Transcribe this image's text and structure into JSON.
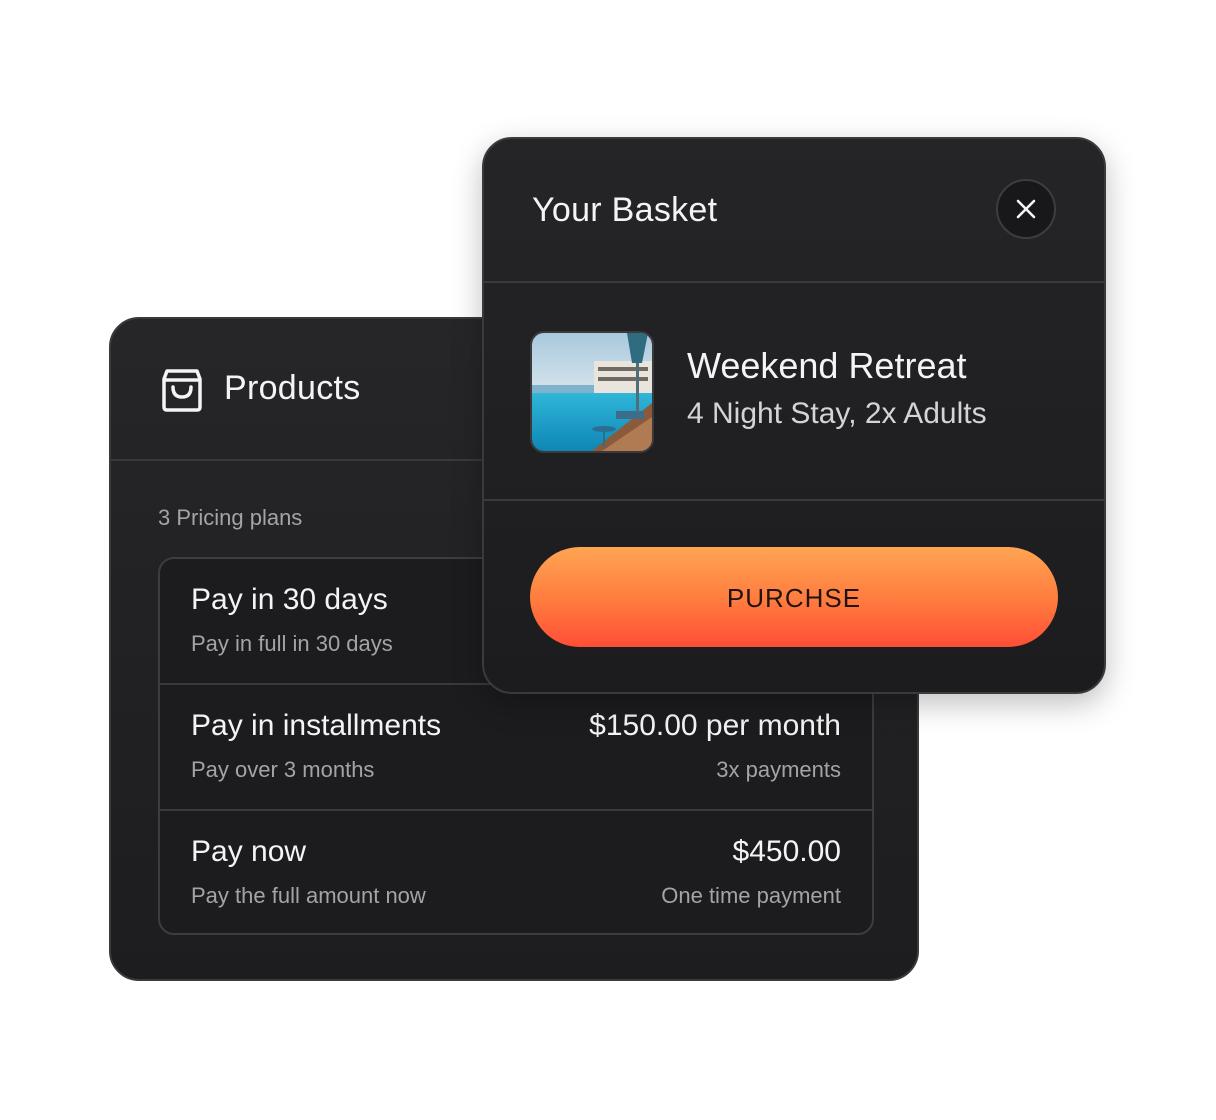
{
  "products": {
    "title": "Products",
    "icon": "shopping-bag-icon",
    "plans_count_label": "3 Pricing plans",
    "plans": [
      {
        "title": "Pay in 30 days",
        "subtitle": "Pay in full in 30 days",
        "price": "",
        "price_note": ""
      },
      {
        "title": "Pay in installments",
        "subtitle": "Pay over 3 months",
        "price": "$150.00 per month",
        "price_note": "3x payments"
      },
      {
        "title": "Pay now",
        "subtitle": "Pay the full amount now",
        "price": "$450.00",
        "price_note": "One time payment"
      }
    ]
  },
  "basket": {
    "title": "Your Basket",
    "close_icon": "close-icon",
    "item": {
      "title": "Weekend Retreat",
      "subtitle": "4 Night Stay, 2x Adults",
      "image": "resort-pool-image"
    },
    "purchase_label": "PURCHSE"
  },
  "colors": {
    "card_bg": "#1f1f21",
    "border": "#3a3a3d",
    "text_primary": "#f4f4f5",
    "text_secondary": "#a3a3a8",
    "purchase_gradient_top": "#ffa552",
    "purchase_gradient_bottom": "#ff4e37"
  }
}
